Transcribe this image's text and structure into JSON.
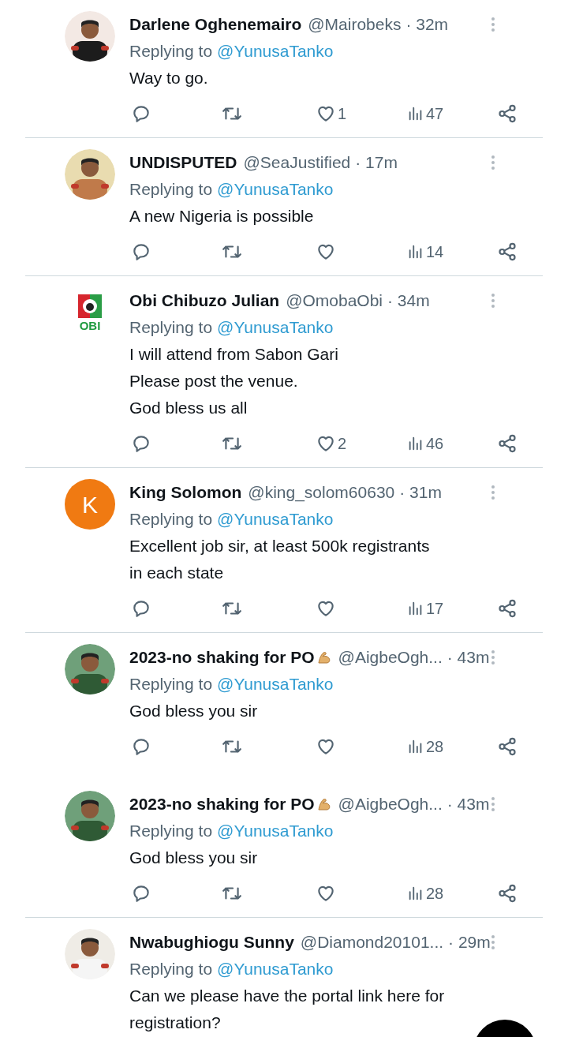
{
  "tweets": [
    {
      "name": "Darlene Oghenemairo",
      "flex_emoji": false,
      "handle": "@Mairobeks",
      "time": "· 32m",
      "replying_label": "Replying to",
      "replying_to": "@YunusaTanko",
      "text": [
        "Way to go."
      ],
      "likes": "1",
      "views": "47",
      "divider_below": true
    },
    {
      "name": "UNDISPUTED",
      "flex_emoji": false,
      "handle": "@SeaJustified",
      "time": "· 17m",
      "replying_label": "Replying to",
      "replying_to": "@YunusaTanko",
      "text": [
        "A new Nigeria is possible"
      ],
      "views": "14",
      "divider_below": true
    },
    {
      "avatar": {
        "kind": "logo",
        "text": "OBI"
      },
      "name": "Obi Chibuzo Julian",
      "flex_emoji": false,
      "handle": "@OmobaObi",
      "time": "· 34m",
      "replying_label": "Replying to",
      "replying_to": "@YunusaTanko",
      "text": [
        "I will attend from Sabon Gari",
        "Please post the venue.",
        "God bless us all"
      ],
      "likes": "2",
      "views": "46",
      "divider_below": true
    },
    {
      "avatar": {
        "kind": "letter",
        "text": "K",
        "color": "#f07a12"
      },
      "name": "King Solomon",
      "flex_emoji": false,
      "handle": "@king_solom60630",
      "time": "· 31m",
      "replying_label": "Replying to",
      "replying_to": "@YunusaTanko",
      "text": [
        "Excellent job sir, at least 500k registrants in each state"
      ],
      "views": "17",
      "divider_below": true
    },
    {
      "name": "2023-no shaking for PO",
      "flex_emoji": true,
      "handle": "@AigbeOgh...",
      "time": "· 43m",
      "replying_label": "Replying to",
      "replying_to": "@YunusaTanko",
      "text": [
        "God bless you sir"
      ],
      "views": "28",
      "divider_below": false
    },
    {
      "name": "2023-no shaking for PO",
      "flex_emoji": true,
      "handle": "@AigbeOgh...",
      "time": "· 43m",
      "replying_label": "Replying to",
      "replying_to": "@YunusaTanko",
      "text": [
        "God bless you sir"
      ],
      "views": "28",
      "divider_below": true
    },
    {
      "name": "Nwabughiogu Sunny",
      "flex_emoji": false,
      "handle": "@Diamond20101...",
      "time": "· 29m",
      "replying_label": "Replying to",
      "replying_to": "@YunusaTanko",
      "text": [
        "Can we please have the portal link here for registration?"
      ],
      "divider_below": false
    }
  ]
}
